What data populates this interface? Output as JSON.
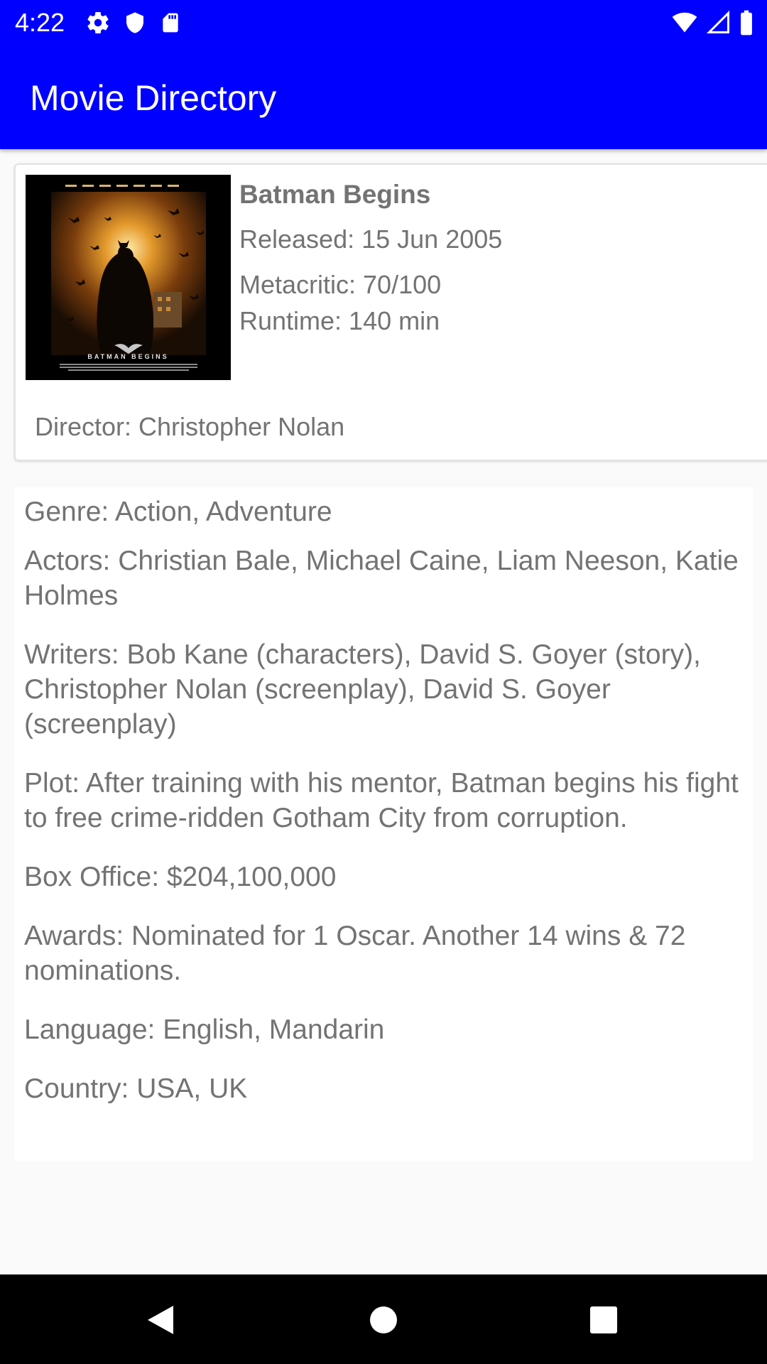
{
  "status_bar": {
    "time": "4:22",
    "left_icons": [
      "settings-icon",
      "shield-icon",
      "sd-card-icon"
    ],
    "right_icons": [
      "wifi-icon",
      "signal-icon",
      "battery-icon"
    ],
    "background": "#0000ff"
  },
  "app_bar": {
    "title": "Movie Directory",
    "background": "#0000ff"
  },
  "movie": {
    "poster_caption": "BATMAN BEGINS",
    "title": "Batman Begins",
    "released": "Released: 15 Jun 2005",
    "metacritic": "Metacritic: 70/100",
    "runtime": "Runtime: 140 min",
    "director": "Director: Christopher Nolan"
  },
  "details": {
    "genre": "Genre: Action, Adventure",
    "actors": "Actors: Christian Bale, Michael Caine, Liam Neeson, Katie Holmes",
    "writers": "Writers: Bob Kane (characters), David S. Goyer (story), Christopher Nolan (screenplay), David S. Goyer (screenplay)",
    "plot": "Plot: After training with his mentor, Batman begins his fight to free crime-ridden Gotham City from corruption.",
    "box_office": "Box Office: $204,100,000",
    "awards": "Awards: Nominated for 1 Oscar. Another 14 wins & 72 nominations.",
    "language": "Language: English, Mandarin",
    "country": "Country: USA, UK"
  },
  "nav_bar": {
    "buttons": [
      "back-icon",
      "home-icon",
      "recents-icon"
    ]
  }
}
